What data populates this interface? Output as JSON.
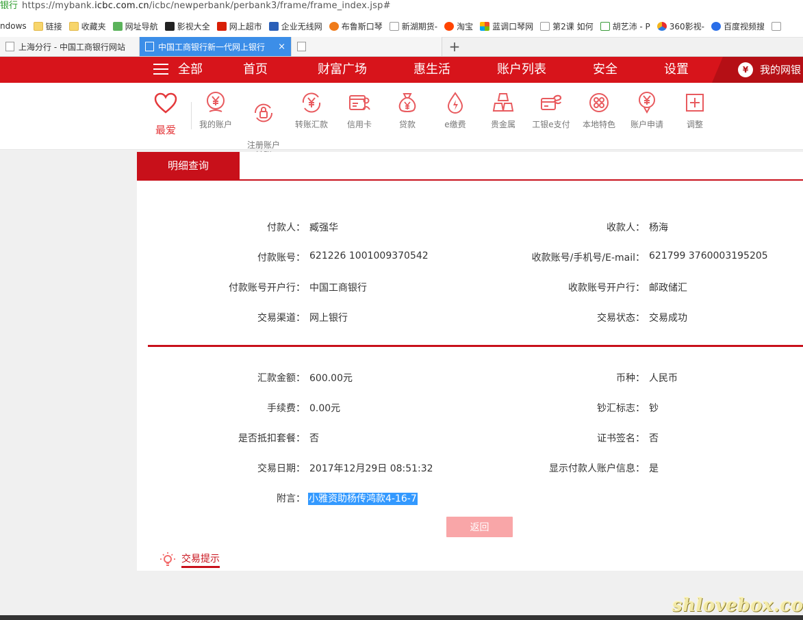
{
  "browser": {
    "address_prefix": "银行",
    "url_scheme": "https://mybank.",
    "url_host": "icbc.com.cn",
    "url_path": "/icbc/newperbank/perbank3/frame/frame_index.jsp#",
    "bookmarks": [
      "ndows",
      "链接",
      "收藏夹",
      "网址导航",
      "影视大全",
      "网上超市",
      "企业无线网",
      "布鲁斯口琴",
      "新湖期货-",
      "淘宝",
      "蓝调口琴网",
      "第2课 如何",
      "胡艺沛 - P",
      "360影视-",
      "百度视频搜"
    ],
    "tabs": [
      {
        "label": "上海分行 - 中国工商银行网站"
      },
      {
        "label": "中国工商银行新一代网上银行",
        "close": "×"
      },
      {
        "label": ""
      }
    ],
    "new_tab": "+"
  },
  "nav": {
    "all": "全部",
    "items": [
      "首页",
      "财富广场",
      "惠生活",
      "账户列表",
      "安全",
      "设置"
    ],
    "mybank": "我的网银",
    "mybank_icon": "¥"
  },
  "icons": {
    "favorite": "最爱",
    "items": [
      {
        "label": "我的账户",
        "icon": "yuan-circle-icon"
      },
      {
        "label": "注册账户\n转账",
        "icon": "refresh-lock-icon"
      },
      {
        "label": "转账汇款",
        "icon": "transfer-yuan-icon"
      },
      {
        "label": "信用卡",
        "icon": "credit-card-icon"
      },
      {
        "label": "贷款",
        "icon": "money-bag-icon"
      },
      {
        "label": "e缴费",
        "icon": "drop-bolt-icon"
      },
      {
        "label": "贵金属",
        "icon": "gold-bars-icon"
      },
      {
        "label": "工银e支付",
        "icon": "epay-card-icon"
      },
      {
        "label": "本地特色",
        "icon": "local-dots-icon"
      },
      {
        "label": "账户申请",
        "icon": "yuan-pin-icon"
      },
      {
        "label": "调整",
        "icon": "plus-square-icon"
      }
    ]
  },
  "detail": {
    "tab": "明细查询",
    "payer_label": "付款人：",
    "payer": "臧强华",
    "payee_label": "收款人：",
    "payee": "杨海",
    "payer_acct_label": "付款账号：",
    "payer_acct": "621226 1001009370542",
    "payee_acct_label": "收款账号/手机号/E-mail：",
    "payee_acct": "621799 3760003195205",
    "payer_bank_label": "付款账号开户行：",
    "payer_bank": "中国工商银行",
    "payee_bank_label": "收款账号开户行：",
    "payee_bank": "邮政储汇",
    "channel_label": "交易渠道：",
    "channel": "网上银行",
    "status_label": "交易状态：",
    "status": "交易成功",
    "amount_label": "汇款金额：",
    "amount": "600.00元",
    "currency_label": "币种：",
    "currency": "人民币",
    "fee_label": "手续费：",
    "fee": "0.00元",
    "cash_flag_label": "钞汇标志：",
    "cash_flag": "钞",
    "package_label": "是否抵扣套餐：",
    "package": "否",
    "cert_label": "证书签名：",
    "cert": "否",
    "date_label": "交易日期：",
    "date": "2017年12月29日 08:51:32",
    "show_payer_label": "显示付款人账户信息：",
    "show_payer": "是",
    "memo_label": "附言：",
    "memo": "小雅资助杨传鸿款4-16-7",
    "back": "返回",
    "tip": "交易提示"
  },
  "watermark": "shlovebox.com"
}
